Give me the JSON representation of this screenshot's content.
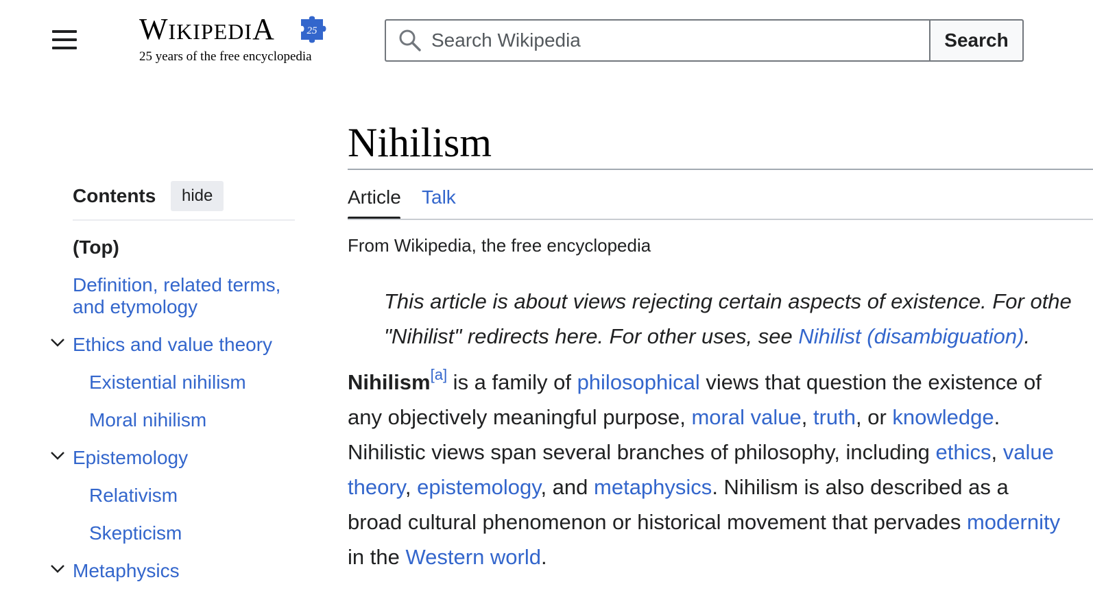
{
  "header": {
    "logo_wordmark_big_w": "W",
    "logo_wordmark_rest": "IKIPEDI",
    "logo_wordmark_big_a": "A",
    "logo_badge": "25",
    "tagline": "25 years of the free encyclopedia",
    "search_placeholder": "Search Wikipedia",
    "search_button": "Search"
  },
  "toc": {
    "title": "Contents",
    "hide_label": "hide",
    "items": [
      {
        "label": "(Top)"
      },
      {
        "label": "Definition, related terms,"
      },
      {
        "label": "and etymology"
      },
      {
        "label": "Ethics and value theory"
      },
      {
        "label": "Existential nihilism"
      },
      {
        "label": "Moral nihilism"
      },
      {
        "label": "Epistemology"
      },
      {
        "label": "Relativism"
      },
      {
        "label": "Skepticism"
      },
      {
        "label": "Metaphysics"
      }
    ]
  },
  "article": {
    "title": "Nihilism",
    "tabs": [
      {
        "label": "Article"
      },
      {
        "label": "Talk"
      }
    ],
    "from": "From Wikipedia, the free encyclopedia",
    "hatnote": {
      "text1": "This article is about views rejecting certain aspects of existence. For othe",
      "text2": "\"Nihilist\" redirects here. For other uses, see ",
      "link": "Nihilist (disambiguation)",
      "text3": "."
    },
    "lead": {
      "bold": "Nihilism",
      "footnote": "[a]",
      "t1": " is a family of ",
      "l_philosophical": "philosophical",
      "t2": " views that question the existence of any objectively meaningful purpose, ",
      "l_moral_value": "moral value",
      "t3": ", ",
      "l_truth": "truth",
      "t4": ", or ",
      "l_knowledge": "knowledge",
      "t5": ". Nihilistic views span several branches of philosophy, including ",
      "l_ethics": "ethics",
      "t6": ", ",
      "l_value_theory": "value theory",
      "t7": ", ",
      "l_epistemology": "epistemology",
      "t8": ", and ",
      "l_metaphysics": "metaphysics",
      "t9": ". Nihilism is also described as a broad cultural phenomenon or historical movement that pervades ",
      "l_modernity": "modernity",
      "t10": " in the ",
      "l_western_world": "Western world",
      "t11": "."
    }
  },
  "colors": {
    "link": "#3366cc",
    "text": "#202122",
    "puzzle": "#3366cc"
  }
}
